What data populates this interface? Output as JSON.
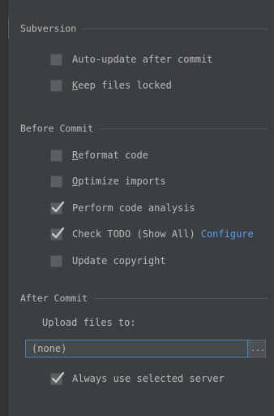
{
  "sections": {
    "subversion": {
      "title": "Subversion",
      "options": [
        {
          "label_pre": "Auto-update after commit",
          "mnemonic": "",
          "label_post": "",
          "checked": false
        },
        {
          "label_pre": "",
          "mnemonic": "K",
          "label_post": "eep files locked",
          "checked": false
        }
      ]
    },
    "before_commit": {
      "title": "Before Commit",
      "options": [
        {
          "label_pre": "",
          "mnemonic": "R",
          "label_post": "eformat code",
          "checked": false
        },
        {
          "label_pre": "",
          "mnemonic": "O",
          "label_post": "ptimize imports",
          "checked": false
        },
        {
          "label_pre": "Perform code analysis",
          "mnemonic": "",
          "label_post": "",
          "checked": true
        },
        {
          "label_pre": "Check TODO (Show All)",
          "mnemonic": "",
          "label_post": "",
          "checked": true,
          "link": "Configure"
        },
        {
          "label_pre": "Update copyright",
          "mnemonic": "",
          "label_post": "",
          "checked": false
        }
      ]
    },
    "after_commit": {
      "title": "After Commit",
      "upload_label": "Upload files to:",
      "server_value": "(none)",
      "ellipsis_label": "...",
      "always_use": {
        "label_pre": "Always use selected server",
        "mnemonic": "",
        "label_post": "",
        "checked": true
      }
    }
  },
  "colors": {
    "background": "#3c3f41",
    "text": "#bbbbbb",
    "link": "#589df6",
    "focus_border": "#3d86c6",
    "checkbox": "#5c5f61",
    "checkmark": "#cfcfcf"
  },
  "icons": {
    "checkmark": "checkmark-icon",
    "dropdown": "triangle-down-icon"
  }
}
